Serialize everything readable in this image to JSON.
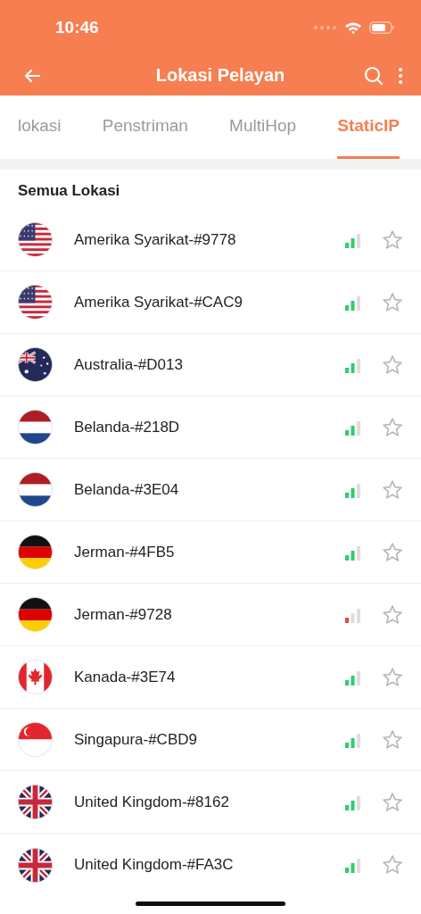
{
  "status_bar": {
    "time": "10:46"
  },
  "app_bar": {
    "title": "Lokasi Pelayan"
  },
  "tabs": [
    {
      "label": "lokasi",
      "selected": false
    },
    {
      "label": "Penstriman",
      "selected": false
    },
    {
      "label": "MultiHop",
      "selected": false
    },
    {
      "label": "StaticIP",
      "selected": true
    }
  ],
  "section_title": "Semua Lokasi",
  "locations": [
    {
      "name": "Amerika Syarikat-#9778",
      "kind": "us",
      "weak_signal": false,
      "starred": false
    },
    {
      "name": "Amerika Syarikat-#CAC9",
      "kind": "us",
      "weak_signal": false,
      "starred": false
    },
    {
      "name": "Australia-#D013",
      "kind": "au",
      "weak_signal": false,
      "starred": false
    },
    {
      "name": "Belanda-#218D",
      "kind": "nl",
      "weak_signal": false,
      "starred": false
    },
    {
      "name": "Belanda-#3E04",
      "kind": "nl",
      "weak_signal": false,
      "starred": false
    },
    {
      "name": "Jerman-#4FB5",
      "kind": "de",
      "weak_signal": false,
      "starred": false
    },
    {
      "name": "Jerman-#9728",
      "kind": "de",
      "weak_signal": true,
      "starred": false
    },
    {
      "name": "Kanada-#3E74",
      "kind": "ca",
      "weak_signal": false,
      "starred": false
    },
    {
      "name": "Singapura-#CBD9",
      "kind": "sg",
      "weak_signal": false,
      "starred": false
    },
    {
      "name": "United Kingdom-#8162",
      "kind": "gb",
      "weak_signal": false,
      "starred": false
    },
    {
      "name": "United Kingdom-#FA3C",
      "kind": "gb",
      "weak_signal": false,
      "starred": false
    }
  ]
}
